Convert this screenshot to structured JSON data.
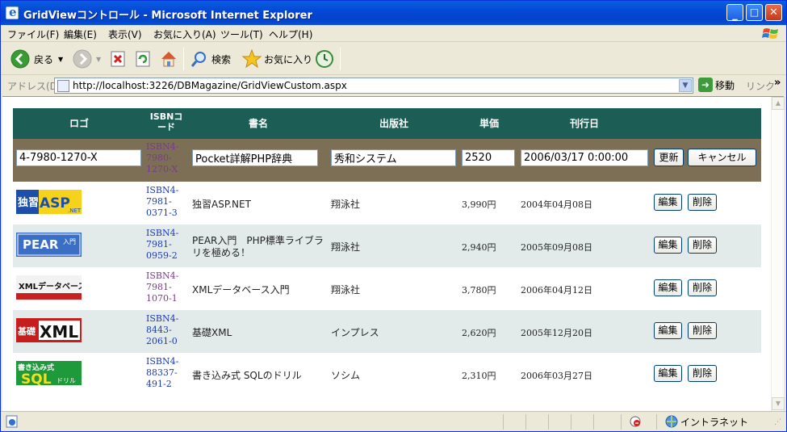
{
  "window": {
    "title": "GridViewコントロール - Microsoft Internet Explorer"
  },
  "menu": [
    "ファイル(F)",
    "編集(E)",
    "表示(V)",
    "お気に入り(A)",
    "ツール(T)",
    "ヘルプ(H)"
  ],
  "toolbar": {
    "back": "戻る",
    "search": "検索",
    "favorites": "お気に入り"
  },
  "address": {
    "label": "アドレス(D)",
    "url": "http://localhost:3226/DBMagazine/GridViewCustom.aspx",
    "go": "移動",
    "links": "リンク"
  },
  "grid": {
    "headers": [
      "ロゴ",
      "ISBNコード",
      "書名",
      "出版社",
      "単価",
      "刊行日"
    ],
    "edit_row": {
      "logo_value": "4-7980-1270-X",
      "isbn": "ISBN4-7980-1270-X",
      "title_value": "Pocket詳解PHP辞典",
      "publisher_value": "秀和システム",
      "price_value": "2520",
      "date_value": "2006/03/17 0:00:00",
      "update_label": "更新",
      "cancel_label": "キャンセル"
    },
    "rows": [
      {
        "logo": "独習ASP.NET",
        "isbn": "ISBN4-7981-0371-3",
        "title": "独習ASP.NET",
        "publisher": "翔泳社",
        "price": "3,990円",
        "date": "2004年04月08日",
        "edit": "編集",
        "delete": "削除"
      },
      {
        "logo": "PEAR入門",
        "isbn": "ISBN4-7981-0959-2",
        "title": "PEAR入門　PHP標準ライブラリを極める！",
        "publisher": "翔泳社",
        "price": "2,940円",
        "date": "2005年09月08日",
        "edit": "編集",
        "delete": "削除"
      },
      {
        "logo": "XMLデータベース入門",
        "isbn": "ISBN4-7981-1070-1",
        "title": "XMLデータベース入門",
        "publisher": "翔泳社",
        "price": "3,780円",
        "date": "2006年04月12日",
        "edit": "編集",
        "delete": "削除"
      },
      {
        "logo": "基礎XML",
        "isbn": "ISBN4-8443-2061-0",
        "title": "基礎XML",
        "publisher": "インプレス",
        "price": "2,620円",
        "date": "2005年12月20日",
        "edit": "編集",
        "delete": "削除"
      },
      {
        "logo": "書き込み式SQLのドリル",
        "isbn": "ISBN4-88337-491-2",
        "title": "書き込み式 SQLのドリル",
        "publisher": "ソシム",
        "price": "2,310円",
        "date": "2006年03月27日",
        "edit": "編集",
        "delete": "削除"
      }
    ]
  },
  "status": {
    "zone": "イントラネット"
  },
  "colors": {
    "header_bg": "#1c5e55",
    "edit_bg": "#7c6f56",
    "alt_row": "#e3ebea",
    "titlebar": "#0548d6"
  }
}
